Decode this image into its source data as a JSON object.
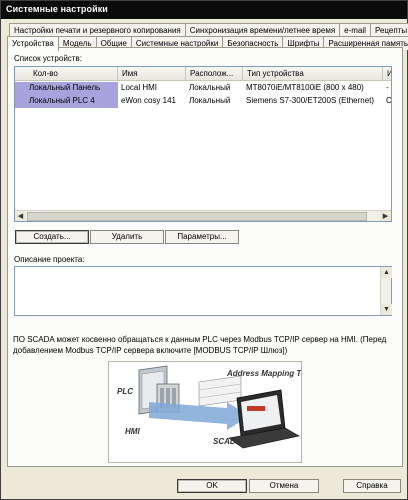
{
  "window": {
    "title": "Системные настройки"
  },
  "tabs_top": [
    "Настройки печати и резервного копирования",
    "Синхронизация времени/летнее время",
    "e-mail",
    "Рецепты"
  ],
  "tabs_bottom": [
    "Устройства",
    "Модель",
    "Общие",
    "Системные настройки",
    "Безопасность",
    "Шрифты",
    "Расширенная память"
  ],
  "devices": {
    "section_label": "Список устройств:",
    "columns": [
      "Кол-во",
      "Имя",
      "Располож...",
      "Тип устройства",
      "И"
    ],
    "rows": [
      [
        "Локальный Панель",
        "Local HMI",
        "Локальный",
        "MT8070iE/MT8100iE (800 x 480)",
        "-"
      ],
      [
        "Локальный PLC 4",
        "eWon cosy 141",
        "Локальный",
        "Siemens S7-300/ET200S (Ethernet)",
        "Ce"
      ]
    ],
    "buttons": {
      "create": "Создать...",
      "delete": "Удалить",
      "params": "Параметры..."
    }
  },
  "description": {
    "label": "Описание проекта:",
    "value": ""
  },
  "note": "ПО SCADA может косвенно обращаться к данным PLC через Modbus TCP/IP сервер на HMI. (Перед добавлением Modbus TCP/IP сервера включите [MODBUS TCP/IP Шлюз])",
  "diagram": {
    "title": "Address Mapping Table",
    "plc": "PLC",
    "hmi": "HMI",
    "scada": "SCADA"
  },
  "footer": {
    "ok": "OK",
    "cancel": "Отмена",
    "help": "Справка"
  }
}
